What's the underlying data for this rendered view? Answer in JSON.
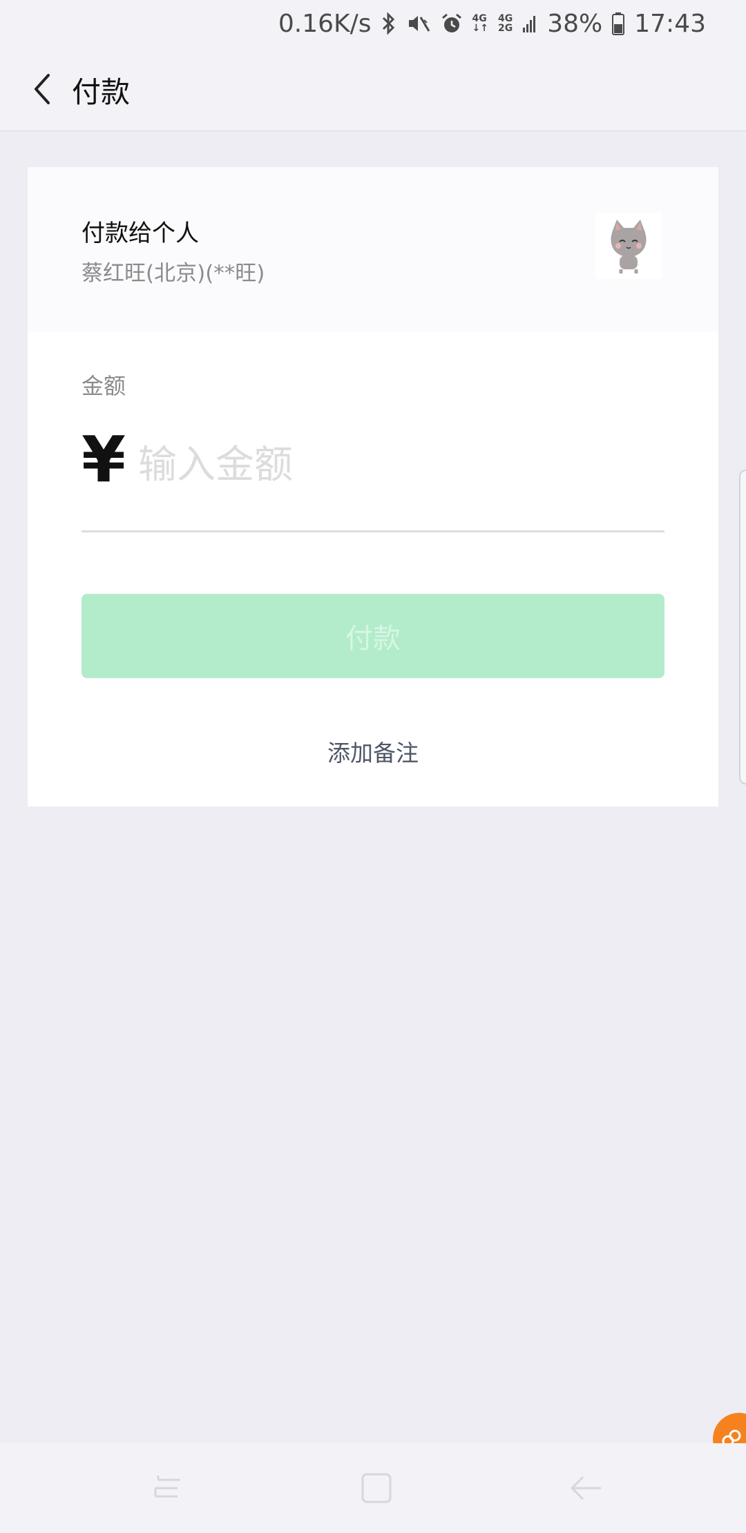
{
  "status_bar": {
    "net_speed": "0.16K/s",
    "network_1": {
      "top": "4G",
      "bottom": "↓↑"
    },
    "network_2": {
      "top": "4G",
      "bottom": "2G"
    },
    "battery": "38%",
    "time": "17:43",
    "icons": [
      "bluetooth-icon",
      "mute-vibrate-icon",
      "alarm-icon",
      "signal-icon",
      "battery-icon"
    ]
  },
  "header": {
    "title": "付款"
  },
  "payee": {
    "title": "付款给个人",
    "name": "蔡红旺(北京)(**旺)",
    "avatar_icon": "cat-avatar"
  },
  "amount": {
    "label": "金额",
    "currency_symbol": "¥",
    "placeholder": "输入金额",
    "value": ""
  },
  "actions": {
    "pay_label": "付款",
    "add_note_label": "添加备注"
  },
  "colors": {
    "accent_green_disabled": "#B3ECCB",
    "floating_orange": "#F5821F",
    "background": "#EEEDF3"
  }
}
